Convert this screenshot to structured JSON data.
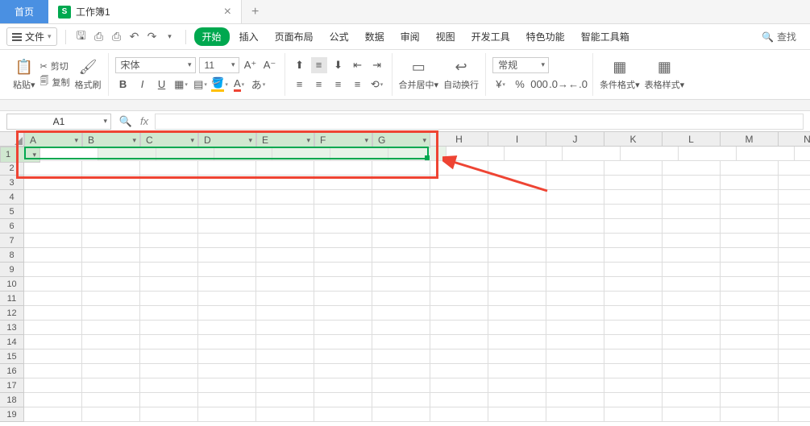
{
  "tabs": {
    "home": "首页",
    "doc": "工作簿1"
  },
  "file_menu": "文件",
  "menus": {
    "start": "开始",
    "insert": "插入",
    "layout": "页面布局",
    "formula": "公式",
    "data": "数据",
    "review": "审阅",
    "view": "视图",
    "dev": "开发工具",
    "special": "特色功能",
    "smart": "智能工具箱"
  },
  "search": "查找",
  "clipboard": {
    "paste": "粘贴",
    "cut": "剪切",
    "copy": "复制",
    "painter": "格式刷"
  },
  "font": {
    "name": "宋体",
    "size": "11"
  },
  "merge": "合并居中",
  "wrap": "自动换行",
  "number_format": "常规",
  "cond_fmt": "条件格式",
  "table_style": "表格样式",
  "namebox": "A1",
  "columns": [
    "A",
    "B",
    "C",
    "D",
    "E",
    "F",
    "G",
    "H",
    "I",
    "J",
    "K",
    "L",
    "M",
    "N"
  ],
  "rows": [
    1,
    2,
    3,
    4,
    5,
    6,
    7,
    8,
    9,
    10,
    11,
    12,
    13,
    14,
    15,
    16,
    17,
    18,
    19
  ],
  "selected_cols_count": 7,
  "selected_row": 1
}
